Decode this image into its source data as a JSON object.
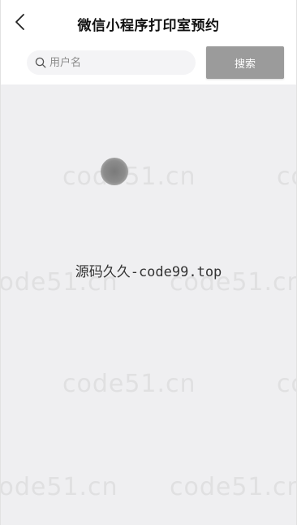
{
  "header": {
    "title": "微信小程序打印室预约",
    "back_icon": "chevron-left-icon"
  },
  "search": {
    "placeholder": "用户名",
    "value": "",
    "icon": "search-icon",
    "button_label": "搜索"
  },
  "content": {
    "center_text": "源码久久-code99.top"
  },
  "watermark": {
    "text": "code51.cn"
  },
  "colors": {
    "background": "#efeff1",
    "search_button": "#9b9b9b",
    "title": "#111111"
  }
}
